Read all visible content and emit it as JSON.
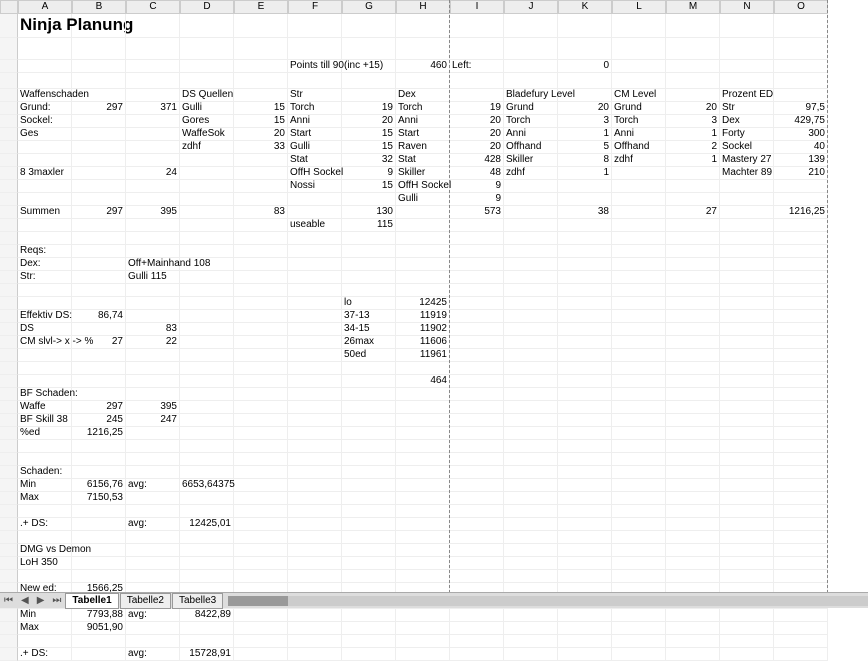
{
  "columns": [
    "",
    "A",
    "B",
    "C",
    "D",
    "E",
    "F",
    "G",
    "H",
    "I",
    "J",
    "K",
    "L",
    "M",
    "N",
    "O"
  ],
  "title": "Ninja Planung",
  "rows": {
    "r3": {
      "F": "Points till 90",
      "G": "(inc +15)",
      "H_r": "460",
      "I": "Left:",
      "K_r": "0"
    },
    "r5": {
      "A": "Waffenschaden",
      "D": "DS Quellen",
      "F": "Str",
      "H": "Dex",
      "J": "Bladefury Level",
      "L": "CM Level",
      "N": "Prozent ED"
    },
    "r6": {
      "A": "Grund:",
      "B_r": "297",
      "C_r": "371",
      "D": "Gulli",
      "E_r": "15",
      "F": "Torch",
      "G_r": "19",
      "H": "Torch",
      "I_r": "19",
      "J": "Grund",
      "K_r": "20",
      "L": "Grund",
      "M_r": "20",
      "N": "Str",
      "O_r": "97,5"
    },
    "r7": {
      "A": "Sockel:",
      "D": "Gores",
      "E_r": "15",
      "F": "Anni",
      "G_r": "20",
      "H": "Anni",
      "I_r": "20",
      "J": "Torch",
      "K_r": "3",
      "L": "Torch",
      "M_r": "3",
      "N": "Dex",
      "O_r": "429,75"
    },
    "r8": {
      "A": "Ges",
      "D": "WaffeSok",
      "E_r": "20",
      "F": "Start",
      "G_r": "15",
      "H": "Start",
      "I_r": "20",
      "J": "Anni",
      "K_r": "1",
      "L": "Anni",
      "M_r": "1",
      "N": "Forty",
      "O_r": "300"
    },
    "r9": {
      "D": "zdhf",
      "E_r": "33",
      "F": "Gulli",
      "G_r": "15",
      "H": "Raven",
      "I_r": "20",
      "J": "Offhand",
      "K_r": "5",
      "L": "Offhand",
      "M_r": "2",
      "N": "Sockel",
      "O_r": "40"
    },
    "r10": {
      "F": "Stat",
      "G_r": "32",
      "H": "Stat",
      "I_r": "428",
      "J": "Skiller",
      "K_r": "8",
      "L": "zdhf",
      "M_r": "1",
      "N": "Mastery 27",
      "O_r": "139"
    },
    "r11": {
      "A": "8 3maxler",
      "C_r": "24",
      "F": "OffH Sockel",
      "G_r": "9",
      "H": "Skiller",
      "I_r": "48",
      "J": "zdhf",
      "K_r": "1",
      "N": "Machter 89",
      "O_r": "210"
    },
    "r12": {
      "F": "Nossi",
      "G_r": "15",
      "H": "OffH Sockel",
      "I_r": "9"
    },
    "r13": {
      "H": "Gulli",
      "I_r": "9"
    },
    "r14": {
      "A": "Summen",
      "B_r": "297",
      "C_r": "395",
      "E_r": "83",
      "G_r": "130",
      "I_r": "573",
      "K_r": "38",
      "M_r": "27",
      "O_r": "1216,25"
    },
    "r15": {
      "F": "useable",
      "G_r": "115"
    },
    "r17": {
      "A": "Reqs:"
    },
    "r18": {
      "A": "Dex:",
      "C": "Off+Mainhand 108"
    },
    "r19": {
      "A": "Str:",
      "C": "Gulli 115"
    },
    "r21": {
      "G": "lo",
      "H_r": "12425"
    },
    "r22": {
      "A": "Effektiv DS:",
      "B_r": "86,74",
      "G": "37-13",
      "H_r": "11919"
    },
    "r23": {
      "A": "DS",
      "C_r": "83",
      "G": "34-15",
      "H_r": "11902"
    },
    "r24": {
      "A": "CM slvl-> x -> %",
      "B_r": "27",
      "C_r": "22",
      "G": "26max",
      "H_r": "11606"
    },
    "r25": {
      "G": "50ed",
      "H_r": "11961"
    },
    "r27": {
      "H_r": "464"
    },
    "r28": {
      "A": "BF Schaden:"
    },
    "r29": {
      "A": "Waffe",
      "B_r": "297",
      "C_r": "395"
    },
    "r30": {
      "A": "BF Skill 38",
      "B_r": "245",
      "C_r": "247"
    },
    "r31": {
      "A": "%ed",
      "B_r": "1216,25"
    },
    "r34": {
      "A": "Schaden:"
    },
    "r35": {
      "A": "Min",
      "B_r": "6156,76",
      "C": "avg:",
      "D_r": "6653,64375"
    },
    "r36": {
      "A": "Max",
      "B_r": "7150,53"
    },
    "r38": {
      "A": ".+ DS:",
      "C": "avg:",
      "D_r": "12425,01"
    },
    "r40": {
      "A": "DMG vs Demon"
    },
    "r41": {
      "A": "LoH 350"
    },
    "r43": {
      "A": "New ed:",
      "B_r": "1566,25"
    },
    "r45": {
      "A": "Min",
      "B_r": "7793,88",
      "C": "avg:",
      "D_r": "8422,89"
    },
    "r46": {
      "A": "Max",
      "B_r": "9051,90"
    },
    "r48": {
      "A": ".+ DS:",
      "C": "avg:",
      "D_r": "15728,91"
    }
  },
  "tabs": {
    "nav": [
      "⏮",
      "◀",
      "▶",
      "⏭"
    ],
    "active": "Tabelle1",
    "others": [
      "Tabelle2",
      "Tabelle3"
    ]
  }
}
